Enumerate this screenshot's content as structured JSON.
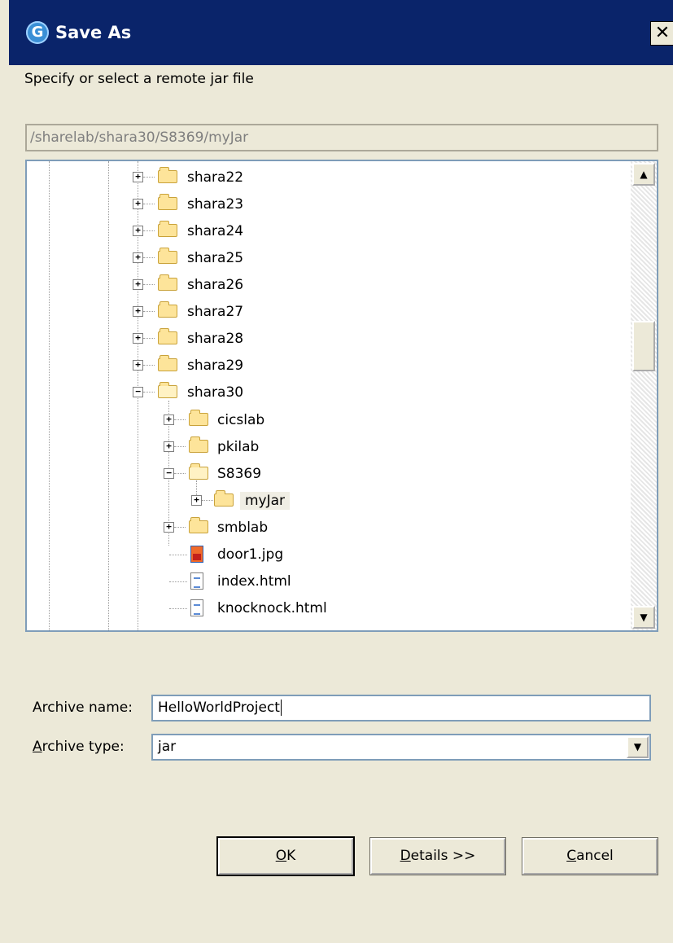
{
  "window": {
    "title": "Save As",
    "app_icon_letter": "G"
  },
  "prompt": "Specify or select a remote jar file",
  "path": "/sharelab/shara30/S8369/myJar",
  "tree": {
    "folders_level1": [
      "shara22",
      "shara23",
      "shara24",
      "shara25",
      "shara26",
      "shara27",
      "shara28",
      "shara29"
    ],
    "expanded_folder": "shara30",
    "shara30_children": [
      "cicslab",
      "pkilab",
      "S8369",
      "smblab"
    ],
    "s8369_children": [
      "myJar"
    ],
    "files": [
      "door1.jpg",
      "index.html",
      "knocknock.html"
    ]
  },
  "form": {
    "archive_name_label": "Archive name:",
    "archive_name_value": "HelloWorldProject",
    "archive_type_label_accel": "A",
    "archive_type_label_rest": "rchive type:",
    "archive_type_value": "jar"
  },
  "buttons": {
    "ok_accel": "O",
    "ok_rest": "K",
    "details_accel": "D",
    "details_rest": "etails >>",
    "cancel_accel": "C",
    "cancel_rest": "ancel"
  }
}
